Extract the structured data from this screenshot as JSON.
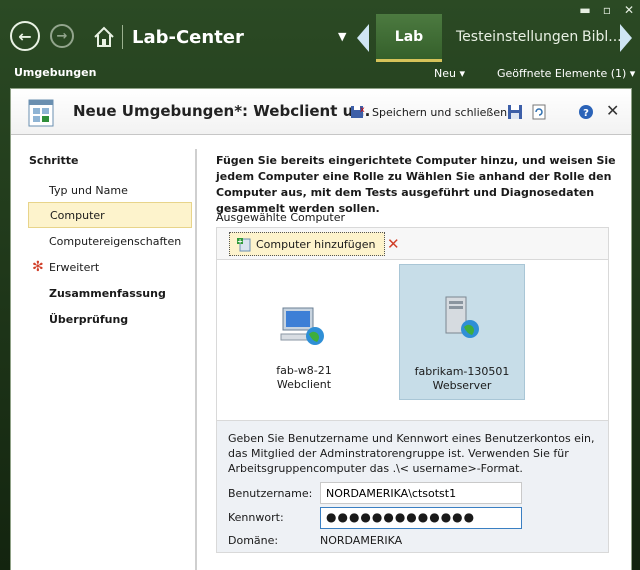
{
  "app": {
    "title": "Lab-Center",
    "tabs": [
      "Lab",
      "Testeinstellungen",
      "Bibl..."
    ],
    "breadcrumb": "Umgebungen",
    "sub_actions": {
      "new": "Neu ▾",
      "open_items": "Geöffnete Elemente (1) ▾"
    }
  },
  "window": {
    "title": "Neue Umgebungen*: Webclient u...",
    "save_close_label": "Speichern und schließen"
  },
  "steps": {
    "title": "Schritte",
    "items": [
      {
        "label": "Typ und Name"
      },
      {
        "label": "Computer"
      },
      {
        "label": "Computereigenschaften"
      },
      {
        "label": "Erweitert"
      },
      {
        "label": "Zusammenfassung"
      },
      {
        "label": "Überprüfung"
      }
    ],
    "active_index": 1
  },
  "content": {
    "instructions": "Fügen Sie bereits eingerichtete Computer hinzu, und weisen Sie jedem Computer eine Rolle zu Wählen Sie anhand der Rolle den Computer aus, mit dem Tests ausgeführt und Diagnosedaten gesammelt werden sollen.",
    "selected_label": "Ausgewählte Computer",
    "add_button": "Computer hinzufügen",
    "computers": [
      {
        "name": "fab-w8-21",
        "role": "Webclient"
      },
      {
        "name": "fabrikam-130501",
        "role": "Webserver"
      }
    ],
    "credentials_text": "Geben Sie Benutzername und Kennwort eines Benutzerkontos ein, das Mitglied der Adminstratorengruppe ist. Verwenden Sie für Arbeitsgruppencomputer das .\\< username>-Format.",
    "username_label": "Benutzername:",
    "username_value": "NORDAMERIKA\\ctsotst1",
    "password_label": "Kennwort:",
    "password_value": "●●●●●●●●●●●●●",
    "domain_label": "Domäne:",
    "domain_value": "NORDAMERIKA"
  }
}
